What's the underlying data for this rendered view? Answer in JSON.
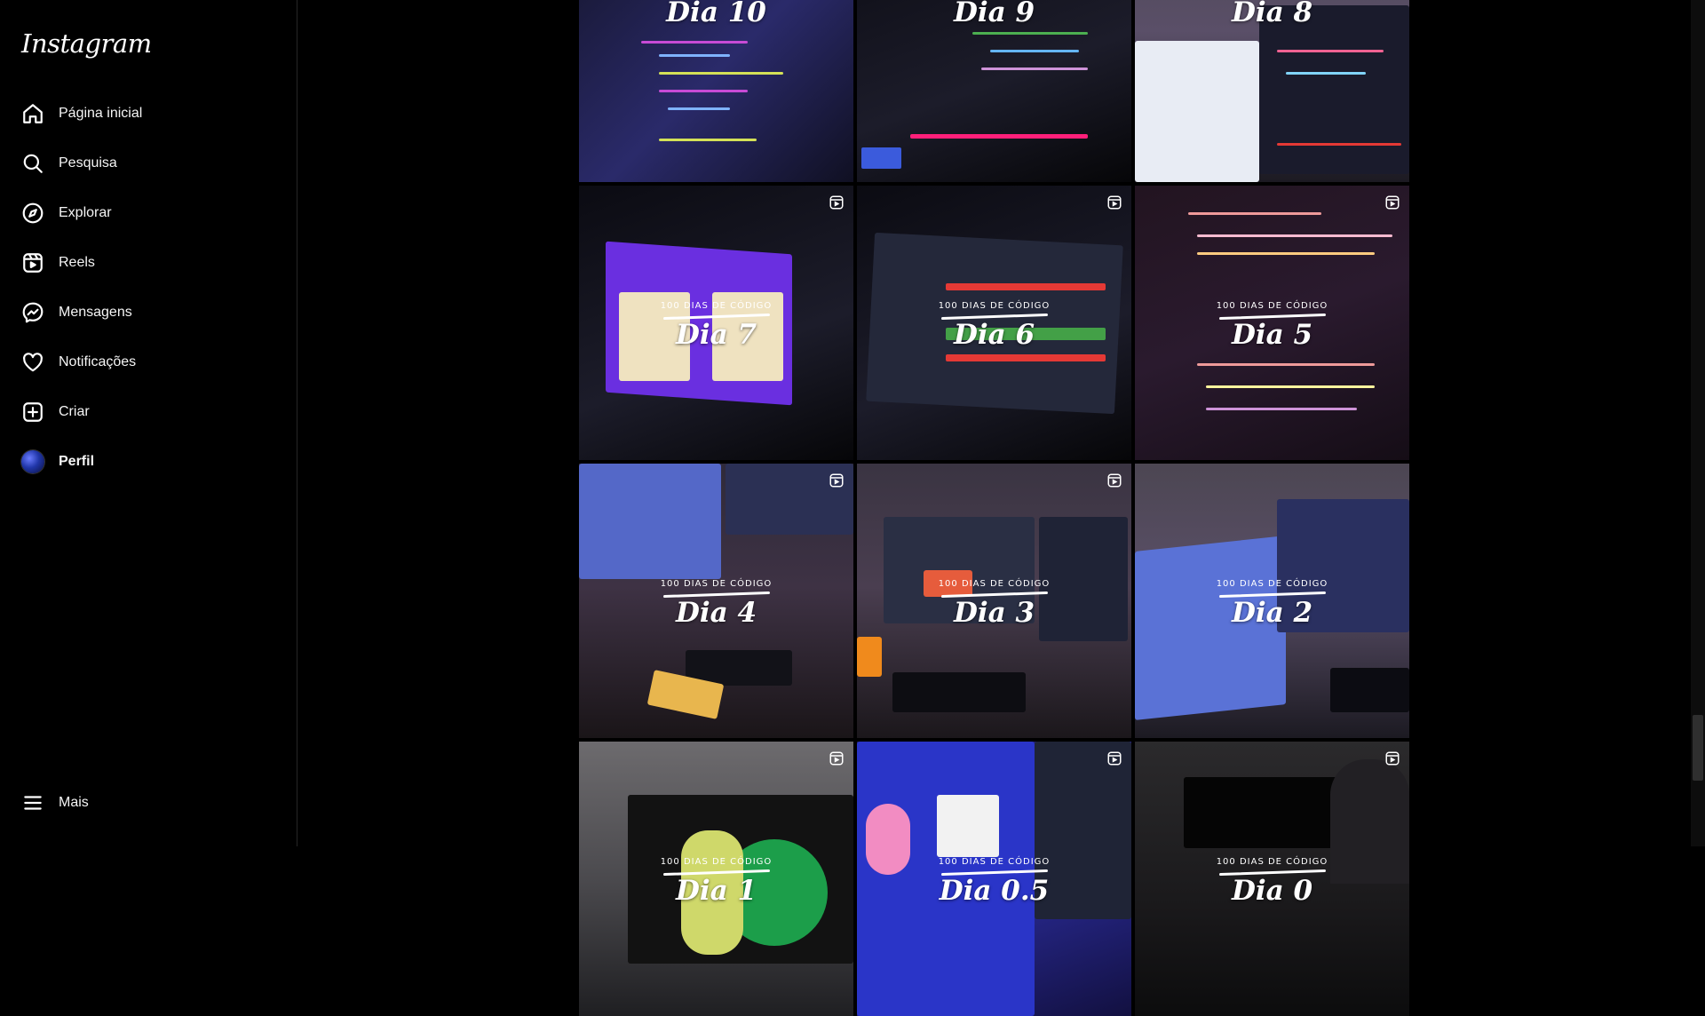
{
  "app": {
    "logo_text": "Instagram"
  },
  "sidebar": {
    "items": [
      {
        "label": "Página inicial",
        "icon": "home-icon"
      },
      {
        "label": "Pesquisa",
        "icon": "search-icon"
      },
      {
        "label": "Explorar",
        "icon": "compass-icon"
      },
      {
        "label": "Reels",
        "icon": "reels-icon"
      },
      {
        "label": "Mensagens",
        "icon": "messenger-icon"
      },
      {
        "label": "Notificações",
        "icon": "heart-icon"
      },
      {
        "label": "Criar",
        "icon": "plus-square-icon"
      },
      {
        "label": "Perfil",
        "icon": "avatar"
      }
    ],
    "more": {
      "label": "Mais",
      "icon": "menu-icon"
    }
  },
  "feed": {
    "overline": "100 DIAS DE CÓDIGO",
    "posts": [
      {
        "day": "Dia 10",
        "reel": false
      },
      {
        "day": "Dia 9",
        "reel": false
      },
      {
        "day": "Dia 8",
        "reel": false
      },
      {
        "day": "Dia 7",
        "reel": true,
        "overline": "100 DIAS DE CÓDIGO"
      },
      {
        "day": "Dia 6",
        "reel": true,
        "overline": "100 DIAS DE CÓDIGO"
      },
      {
        "day": "Dia 5",
        "reel": true,
        "overline": "100 DIAS DE CÓDIGO"
      },
      {
        "day": "Dia 4",
        "reel": true,
        "overline": "100 DIAS DE CÓDIGO"
      },
      {
        "day": "Dia 3",
        "reel": true,
        "overline": "100 DIAS DE CÓDIGO"
      },
      {
        "day": "Dia 2",
        "reel": false,
        "overline": "100 DIAS DE CÓDIGO"
      },
      {
        "day": "Dia 1",
        "reel": true,
        "overline": "100 DIAS DE CÓDIGO"
      },
      {
        "day": "Dia 0.5",
        "reel": true,
        "overline": "100 DIAS DE CÓDIGO"
      },
      {
        "day": "Dia 0",
        "reel": true,
        "overline": "100 DIAS DE CÓDIGO"
      }
    ]
  },
  "colors": {
    "background": "#000000",
    "text": "#f5f5f5",
    "border": "#262626"
  }
}
